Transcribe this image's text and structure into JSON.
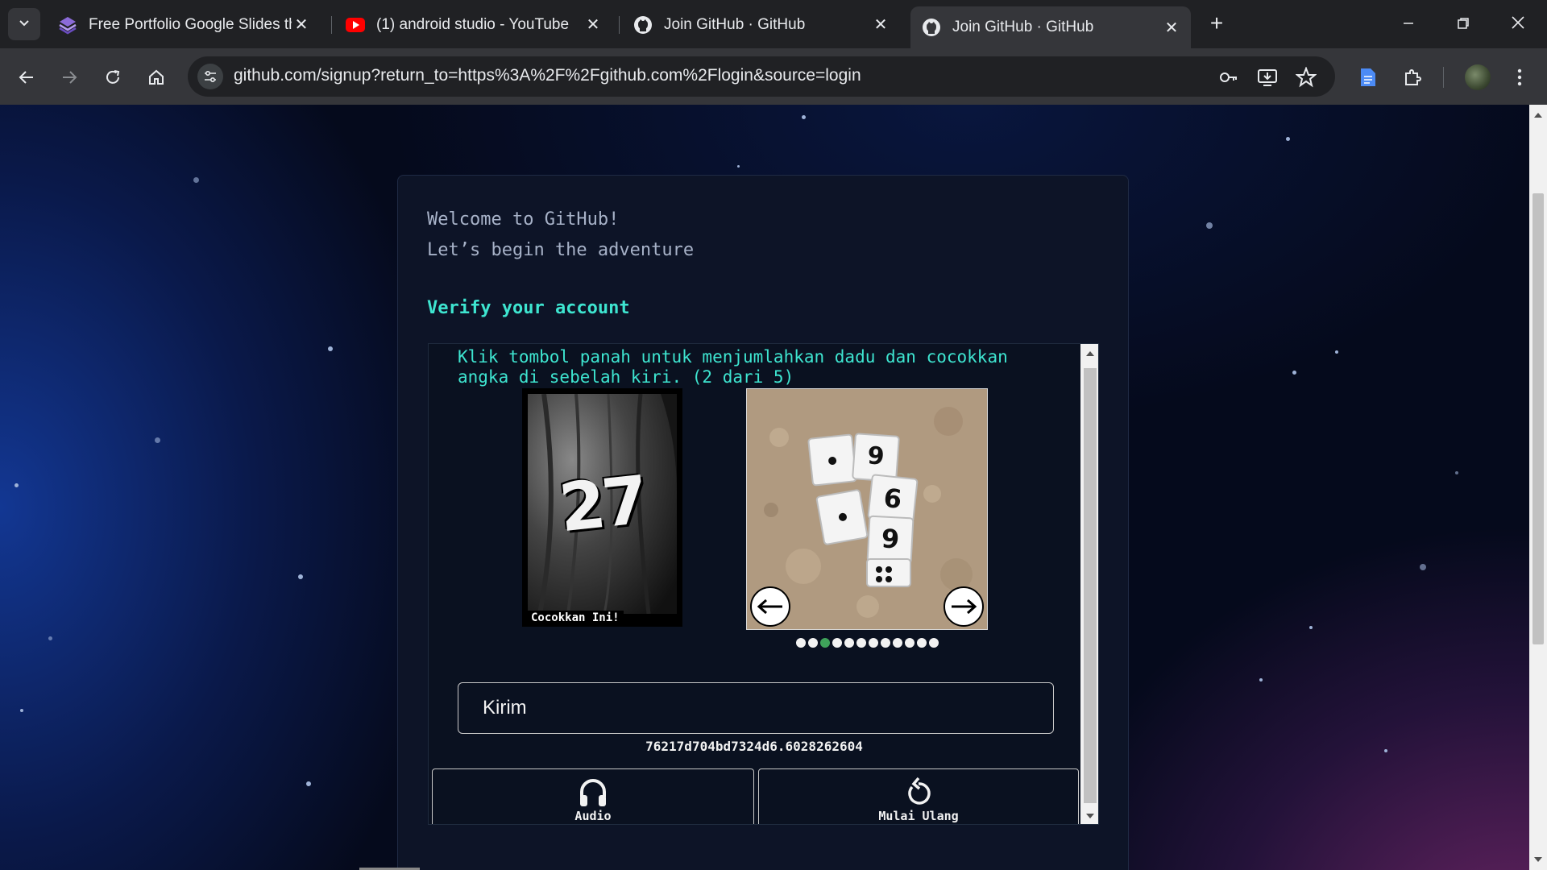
{
  "browser": {
    "tabs": [
      {
        "title": "Free Portfolio Google Slides the",
        "icon": "slidesgo-icon"
      },
      {
        "title": "(1) android studio - YouTube",
        "icon": "youtube-icon"
      },
      {
        "title": "Join GitHub · GitHub",
        "icon": "github-icon"
      },
      {
        "title": "Join GitHub · GitHub",
        "icon": "github-icon",
        "active": true
      }
    ],
    "url": "github.com/signup?return_to=https%3A%2F%2Fgithub.com%2Flogin&source=login"
  },
  "page": {
    "welcome_line1": "Welcome to GitHub!",
    "welcome_line2": "Let’s begin the adventure",
    "verify_heading": "Verify your account"
  },
  "captcha": {
    "instruction": "Klik tombol panah untuk menjumlahkan dadu dan cocokkan angka di sebelah kiri. (2 dari 5)",
    "target_number": "27",
    "target_label": "Cocokkan Ini!",
    "dice_faces": [
      "1",
      "9",
      "1",
      "6",
      "9",
      "4"
    ],
    "progress": {
      "total_dots": 12,
      "current_dot": 3
    },
    "submit_label": "Kirim",
    "session_id": "76217d704bd7324d6.6028262604",
    "audio_label": "Audio",
    "restart_label": "Mulai Ulang"
  },
  "colors": {
    "accent": "#3ee5d0",
    "card_bg": "#0d1427",
    "progress_active": "#3fa35a"
  }
}
